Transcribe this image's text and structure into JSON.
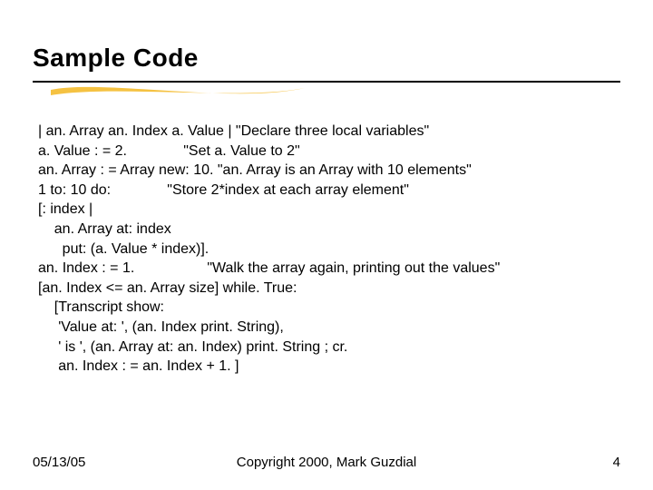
{
  "title": "Sample Code",
  "code_lines": [
    "| an. Array an. Index a. Value | \"Declare three local variables\"",
    "a. Value : = 2.              \"Set a. Value to 2\"",
    "an. Array : = Array new: 10. \"an. Array is an Array with 10 elements\"",
    "1 to: 10 do:              \"Store 2*index at each array element\"",
    "[: index |",
    "    an. Array at: index",
    "      put: (a. Value * index)].",
    "an. Index : = 1.                  \"Walk the array again, printing out the values\"",
    "[an. Index <= an. Array size] while. True:",
    "    [Transcript show:",
    "     'Value at: ', (an. Index print. String),",
    "     ' is ', (an. Array at: an. Index) print. String ; cr.",
    "     an. Index : = an. Index + 1. ]"
  ],
  "footer": {
    "date": "05/13/05",
    "copyright": "Copyright 2000, Mark Guzdial",
    "page": "4"
  }
}
